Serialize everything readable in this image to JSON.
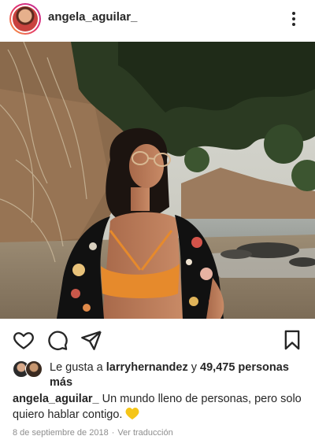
{
  "post": {
    "username": "angela_aguilar_",
    "likes_prefix": "Le gusta a",
    "liked_by": "larryhernandez",
    "likes_join": "y",
    "likes_count": "49,475 personas más",
    "caption_username": "angela_aguilar_",
    "caption_text": "Un mundo lleno de personas, pero solo quiero hablar contigo.",
    "caption_emoji": "yellow-heart",
    "date": "8 de septiembre de 2018",
    "separator": "·",
    "translate_link": "Ver traducción"
  },
  "icons": {
    "more": "more-vertical-icon",
    "like": "heart-icon",
    "comment": "comment-icon",
    "share": "send-icon",
    "save": "bookmark-icon"
  },
  "colors": {
    "text": "#262626",
    "secondary": "#8e8e8e",
    "story_ring_start": "#f9a13a",
    "story_ring_end": "#c22b9c",
    "heart_emoji": "#f5c518"
  }
}
